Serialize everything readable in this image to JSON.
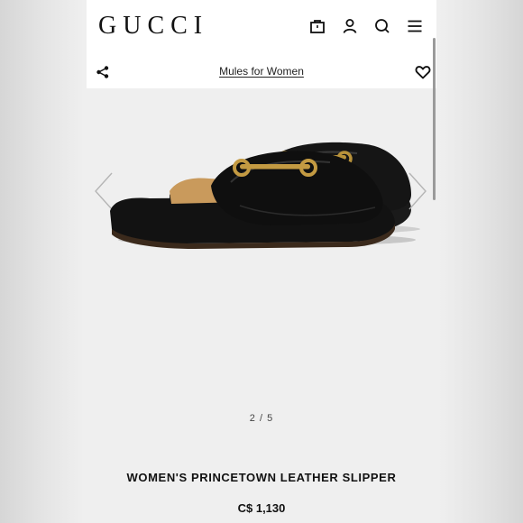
{
  "header": {
    "logo": "GUCCI",
    "icons": [
      "shopping-bag-icon",
      "account-icon",
      "search-icon",
      "menu-icon"
    ]
  },
  "subbar": {
    "breadcrumb": "Mules for Women",
    "icons": [
      "share-icon",
      "heart-icon"
    ]
  },
  "gallery": {
    "pager": "2 / 5",
    "image": "black leather slipper with gold horsebit"
  },
  "product": {
    "name": "WOMEN'S PRINCETOWN LEATHER SLIPPER",
    "price": "C$ 1,130"
  },
  "colors": {
    "background": "#efefef",
    "header": "#ffffff",
    "text": "#111111",
    "leather": "#141414",
    "hardware": "#b8923a",
    "insole": "#c99a5c"
  }
}
